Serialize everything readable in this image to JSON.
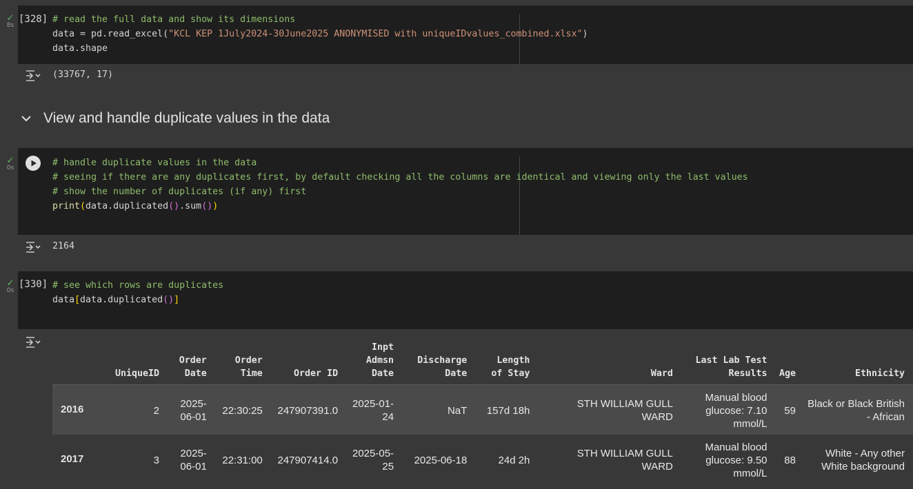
{
  "cells": {
    "c1": {
      "count": "[328]",
      "time": "8s",
      "lines": [
        "# read the full data and show its dimensions",
        "data = pd.read_excel(",
        "\"KCL KEP 1July2024-30June2025 ANONYMISED with uniqueIDvalues_combined.xlsx\"",
        ")",
        "data.shape"
      ],
      "output": "(33767, 17)"
    },
    "section": {
      "title": "View and handle duplicate values in the data"
    },
    "c2": {
      "time": "0s",
      "lines": [
        "# handle duplicate values in the data",
        "# seeing if there are any duplicates first, by default checking all the columns are identical and viewing only the last values",
        "# show the number of duplicates (if any) first",
        "print",
        "(",
        "data.duplicated",
        "()",
        ".sum",
        "()",
        ")"
      ],
      "output": "2164"
    },
    "c3": {
      "count": "[330]",
      "time": "0s",
      "lines": [
        "# see which rows are duplicates",
        "data",
        "[",
        "data.duplicated",
        "()",
        "]"
      ]
    }
  },
  "table": {
    "columns": [
      "UniqueID",
      "Order Date",
      "Order Time",
      "Order ID",
      "Inpt Admsn Date",
      "Discharge Date",
      "Length of Stay",
      "Ward",
      "Last Lab Test Results",
      "Age",
      "Ethnicity"
    ],
    "rows": [
      {
        "index": "2016",
        "cells": [
          "2",
          "2025-06-01",
          "22:30:25",
          "247907391.0",
          "2025-01-24",
          "NaT",
          "157d 18h",
          "STH WILLIAM GULL WARD",
          "Manual blood glucose: 7.10 mmol/L",
          "59",
          "Black or Black British - African"
        ]
      },
      {
        "index": "2017",
        "cells": [
          "3",
          "2025-06-01",
          "22:31:00",
          "247907414.0",
          "2025-05-25",
          "2025-06-18",
          "24d 2h",
          "STH WILLIAM GULL WARD",
          "Manual blood glucose: 9.50 mmol/L",
          "88",
          "White - Any other White background"
        ]
      }
    ]
  },
  "icons": {
    "check": "✓",
    "output-toggle": "output-collapse-icon",
    "chevron": "chevron-down-icon",
    "run": "play-icon"
  },
  "colors": {
    "code_bg": "#1e1e1e",
    "page_bg": "#383838",
    "comment": "#8fbc6b",
    "string": "#ce9178",
    "function": "#dcdcaa",
    "success": "#5fb760"
  }
}
